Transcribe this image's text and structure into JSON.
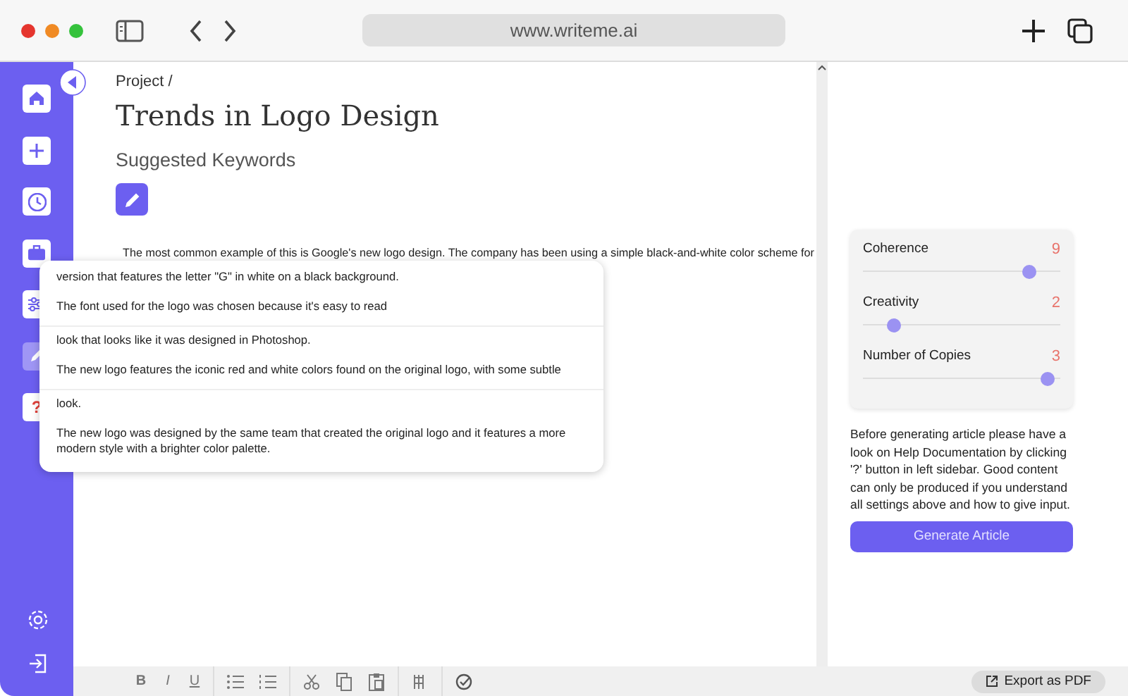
{
  "browser": {
    "url": "www.writeme.ai"
  },
  "sidebar": {
    "items": [
      {
        "kind": "home",
        "selected": false
      },
      {
        "kind": "add",
        "selected": false
      },
      {
        "kind": "history",
        "selected": false
      },
      {
        "kind": "briefcase",
        "selected": false
      },
      {
        "kind": "sliders",
        "selected": false
      },
      {
        "kind": "pen",
        "selected": true
      },
      {
        "kind": "help",
        "label": "?",
        "selected": false
      }
    ],
    "bottom_items": [
      {
        "kind": "settings"
      },
      {
        "kind": "logout"
      }
    ]
  },
  "breadcrumb": "Project /",
  "title": "Trends in Logo Design",
  "subtitle": "Suggested Keywords",
  "editor": {
    "text": "The most common example of this is Google's new logo design. The company has been using a simple black-and-white color scheme for"
  },
  "suggestions": [
    {
      "items": [
        "version that features the letter \"G\" in white on a black background.",
        "The font used for the logo was chosen because it's easy to read"
      ]
    },
    {
      "items": [
        "look that looks like it was designed in Photoshop.",
        "The new logo features the iconic red and white colors found on the original logo, with some subtle"
      ]
    },
    {
      "items": [
        "look.",
        "The new logo was designed by the same team that created the original logo and it features a more modern style with a brighter color palette."
      ]
    }
  ],
  "settings": {
    "sliders": [
      {
        "label": "Coherence",
        "value": "9",
        "level": 0.87
      },
      {
        "label": "Creativity",
        "value": "2",
        "level": 0.13
      },
      {
        "label": "Number of Copies",
        "value": "3",
        "level": 0.97
      }
    ],
    "note": "Before generating article please have a look on Help Documentation by clicking '?' button in left sidebar. Good content can only be produced if you understand all settings above and how to give input.",
    "generate_button": "Generate Article"
  },
  "toolbar": {
    "groups": [
      [
        {
          "kind": "bold",
          "label": "B"
        },
        {
          "kind": "italic",
          "label": "I"
        },
        {
          "kind": "underline",
          "label": "U"
        }
      ],
      [
        {
          "kind": "bullets"
        },
        {
          "kind": "numbers"
        }
      ],
      [
        {
          "kind": "cut"
        },
        {
          "kind": "copy"
        },
        {
          "kind": "paste"
        }
      ],
      [
        {
          "kind": "columns"
        }
      ],
      [
        {
          "kind": "check"
        }
      ]
    ],
    "export_button": "Export as PDF"
  }
}
